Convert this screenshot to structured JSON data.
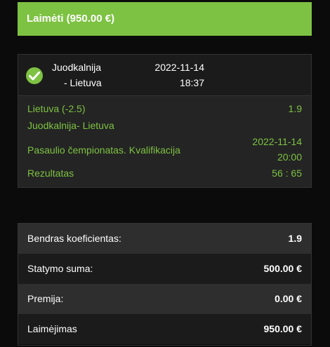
{
  "banner": {
    "text": "Laimėti (950.00 €)"
  },
  "bet": {
    "match_line1": "Juodkalnija",
    "match_line2": "- Lietuva",
    "date": "2022-11-14",
    "time": "18:37",
    "selection": "Lietuva (-2.5)",
    "odds": "1.9",
    "event": "Juodkalnija- Lietuva",
    "competition": "Pasaulio čempionatas. Kvalifikacija",
    "event_date": "2022-11-14",
    "event_time": "20:00",
    "result_label": "Rezultatas",
    "result_value": "56 : 65"
  },
  "summary": {
    "rows": [
      {
        "label": "Bendras koeficientas:",
        "value": "1.9"
      },
      {
        "label": "Statymo suma:",
        "value": "500.00 €"
      },
      {
        "label": "Premija:",
        "value": "0.00 €"
      },
      {
        "label": "Laimėjimas",
        "value": "950.00 €"
      }
    ]
  },
  "colors": {
    "accent": "#7dc242",
    "background": "#0b0b0b",
    "panel_dark": "#1b1b1b",
    "panel_light": "#2e2e2e"
  }
}
